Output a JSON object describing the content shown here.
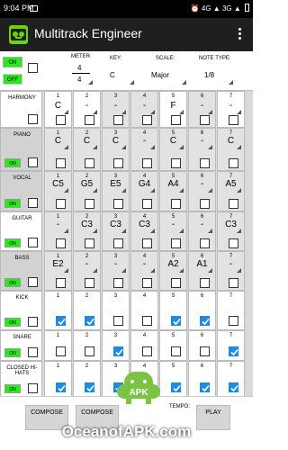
{
  "status": {
    "time": "9:04 PM",
    "network": "4G",
    "network2": "3G",
    "battery_icon": "battery-icon"
  },
  "app": {
    "title": "Multitrack Engineer",
    "menu_icon": "overflow-menu-icon"
  },
  "controls": {
    "on_label": "ON",
    "off_label": "OFF",
    "meter_label": "METER:",
    "meter_top": "4",
    "meter_bottom": "4",
    "key_label": "KEY:",
    "key_value": "C",
    "scale_label": "SCALE:",
    "scale_value": "Major",
    "note_type_label": "NOTE TYPE:",
    "note_type_value": "1/8"
  },
  "tracks": [
    {
      "name": "HARMONY",
      "cells": [
        "C",
        "-",
        "-",
        "-",
        "F",
        "-",
        "-"
      ],
      "has_toggle": false
    },
    {
      "name": "PIANO",
      "cells": [
        "C",
        "C",
        "C",
        "-",
        "C",
        "-",
        "C"
      ],
      "has_toggle": true
    },
    {
      "name": "VOCAL",
      "cells": [
        "C5",
        "G5",
        "E5",
        "G4",
        "A4",
        "-",
        "A5"
      ],
      "has_toggle": true
    },
    {
      "name": "GUITAR",
      "cells": [
        "-",
        "C3",
        "C3",
        "C3",
        "-",
        "-",
        "C3"
      ],
      "has_toggle": true
    },
    {
      "name": "BASS",
      "cells": [
        "E2",
        "-",
        "-",
        "-",
        "A2",
        "A1",
        "-"
      ],
      "has_toggle": true
    },
    {
      "name": "KICK",
      "checks": [
        true,
        true,
        false,
        false,
        true,
        true,
        false
      ],
      "has_toggle": true
    },
    {
      "name": "SNARE",
      "checks": [
        false,
        false,
        true,
        false,
        false,
        false,
        true
      ],
      "has_toggle": true
    },
    {
      "name": "CLOSED HI-HATS",
      "checks": [
        true,
        true,
        true,
        true,
        true,
        true,
        true
      ],
      "has_toggle": true
    }
  ],
  "track_on_label": "ON",
  "bottom": {
    "compose_label": "COMPOSE",
    "compose2_label": "COMPOSE",
    "tempo_label": "TEMPO:",
    "play_label": "PLAY"
  },
  "watermark": "OceanofAPK.com",
  "watermark_logo_text": "APK"
}
